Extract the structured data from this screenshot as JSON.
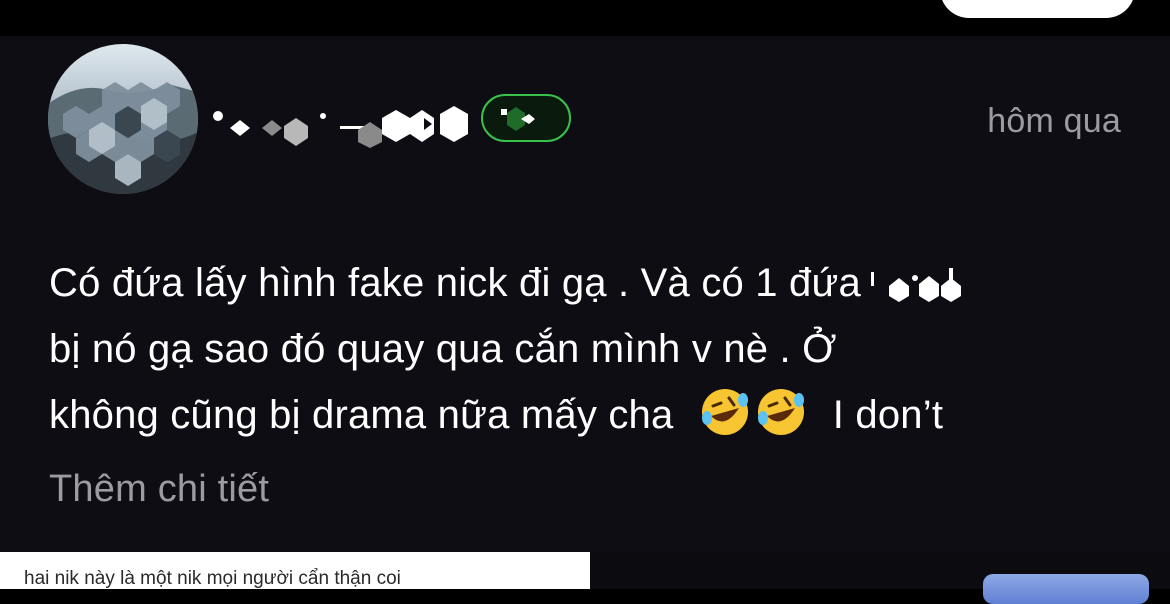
{
  "post": {
    "timestamp": "hôm qua",
    "text_lines": [
      "Có đứa lấy hình fake nick đi gạ . Và có 1 đứa",
      "bị nó gạ sao đó quay qua cắn mình v nè . Ở",
      "không cũng bị drama nữa mấy cha",
      "I don’t"
    ],
    "more_label": "Thêm chi tiết",
    "emojis": [
      "rolling-on-floor-laughing",
      "rolling-on-floor-laughing"
    ]
  },
  "comment_preview": {
    "text": "hai nik này là một nik mọi người cẩn thận coi"
  },
  "colors": {
    "background": "#000000",
    "card": "#0e0d14",
    "text": "#ffffff",
    "muted": "#9c9aa3",
    "badge_border": "#39c24a",
    "accent_blue": "#6d8bdc"
  }
}
